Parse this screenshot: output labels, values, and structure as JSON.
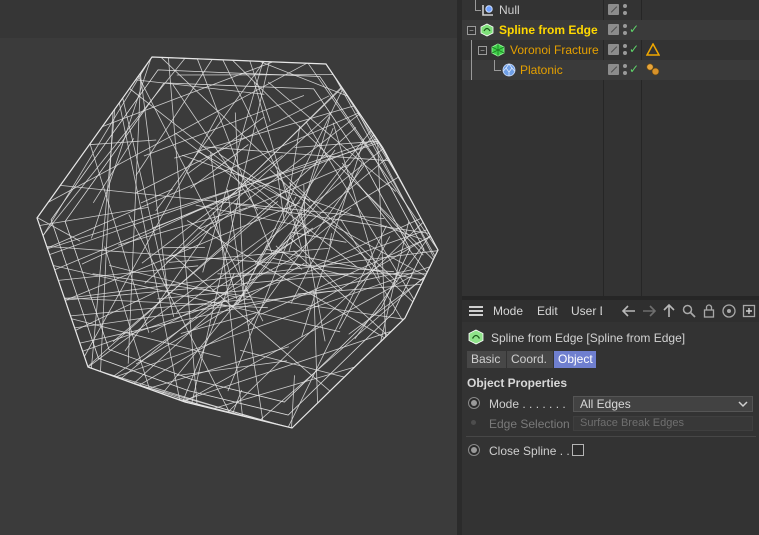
{
  "viewport": {
    "object_shape": "icosahedral-wireframe"
  },
  "object_manager": {
    "rows": [
      {
        "name": "Null",
        "icon": "null-object-icon",
        "color": "#cfcfcf"
      },
      {
        "name": "Spline from Edge",
        "icon": "spline-from-edge-icon",
        "color": "#ffd800",
        "tag": "check"
      },
      {
        "name": "Voronoi Fracture",
        "icon": "voronoi-fracture-icon",
        "color": "#e5a000",
        "tag": "warning-triangle-icon"
      },
      {
        "name": "Platonic",
        "icon": "platonic-icon",
        "color": "#e5a000",
        "tag": "material-tag-icon"
      }
    ]
  },
  "attribute_manager": {
    "menu": [
      "Mode",
      "Edit",
      "User D"
    ],
    "toolbar_icons": [
      "back-arrow-icon",
      "forward-arrow-icon",
      "up-arrow-icon",
      "search-icon",
      "lock-icon",
      "target-icon",
      "add-panel-icon"
    ],
    "object_title": "Spline from Edge [Spline from Edge]",
    "tabs": [
      "Basic",
      "Coord.",
      "Object"
    ],
    "active_tab": "Object",
    "section_title": "Object Properties",
    "params": {
      "mode_label": "Mode . . . . . . .",
      "mode_value": "All Edges",
      "edge_selection_label": "Edge Selection",
      "edge_selection_placeholder": "Surface Break Edges",
      "close_spline_label": "Close Spline . .",
      "close_spline_checked": false
    },
    "colors": {
      "active_tab": "#6f7fcf",
      "selected_object": "#ffd800",
      "child_object": "#e5a000"
    }
  }
}
